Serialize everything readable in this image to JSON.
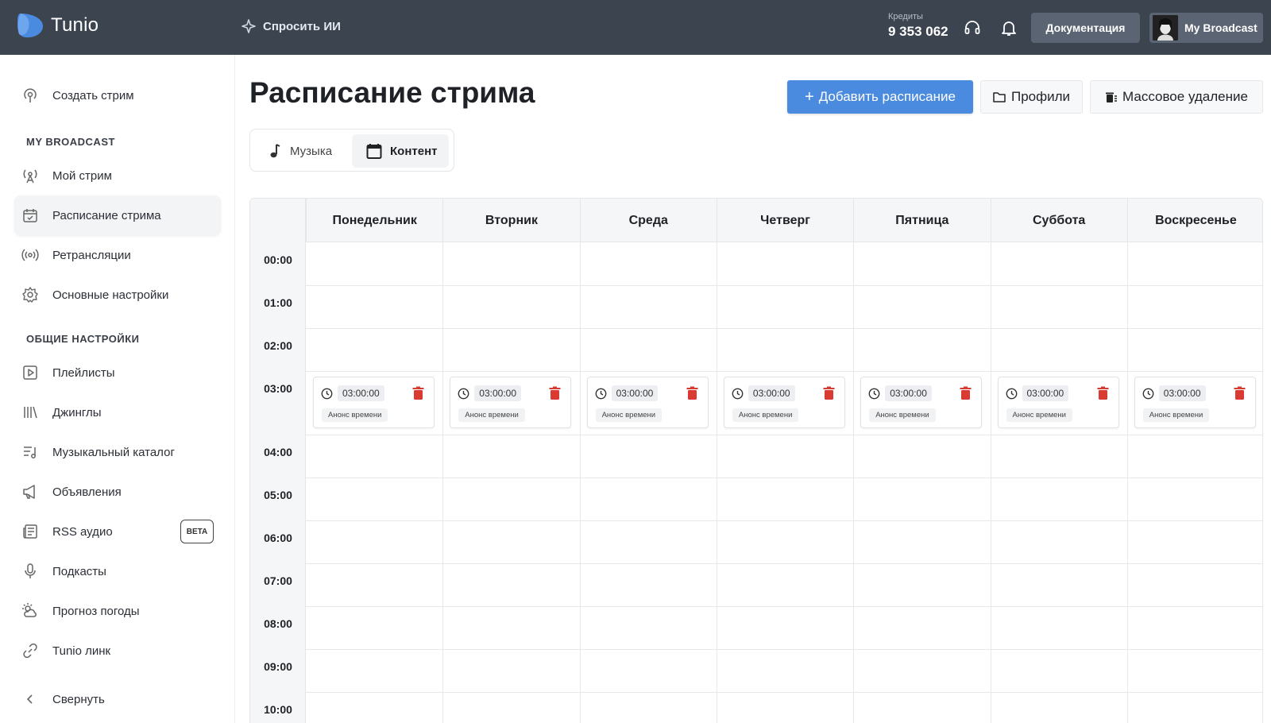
{
  "topbar": {
    "app_name": "Tunio",
    "ask_ai": "Спросить ИИ",
    "credits_label": "Кредиты",
    "credits_value": "9 353 062",
    "docs_button": "Документация",
    "profile_name": "My Broadcast"
  },
  "sidebar": {
    "create_stream": "Создать стрим",
    "section_broadcast": "MY BROADCAST",
    "my_stream": "Мой стрим",
    "schedule": "Расписание стрима",
    "relays": "Ретрансляции",
    "main_settings": "Основные настройки",
    "section_general": "ОБЩИЕ НАСТРОЙКИ",
    "playlists": "Плейлисты",
    "jingles": "Джинглы",
    "music_catalog": "Музыкальный каталог",
    "announcements": "Объявления",
    "rss_audio": "RSS аудио",
    "beta_badge": "BETA",
    "podcasts": "Подкасты",
    "weather": "Прогноз погоды",
    "tunio_link": "Tunio линк",
    "collapse": "Свернуть"
  },
  "main": {
    "title": "Расписание стрима",
    "add_schedule": "Добавить расписание",
    "profiles": "Профили",
    "bulk_delete": "Массовое удаление",
    "tabs": {
      "music": "Музыка",
      "content": "Контент"
    },
    "days": [
      "Понедельник",
      "Вторник",
      "Среда",
      "Четверг",
      "Пятница",
      "Суббота",
      "Воскресенье"
    ],
    "times": [
      "00:00",
      "01:00",
      "02:00",
      "03:00",
      "04:00",
      "05:00",
      "06:00",
      "07:00",
      "08:00",
      "09:00",
      "10:00"
    ],
    "event": {
      "time": "03:00:00",
      "label": "Анонс времени"
    }
  },
  "colors": {
    "topbar": "#3c4450",
    "primary": "#4a8be0",
    "delete": "#d93a32"
  }
}
